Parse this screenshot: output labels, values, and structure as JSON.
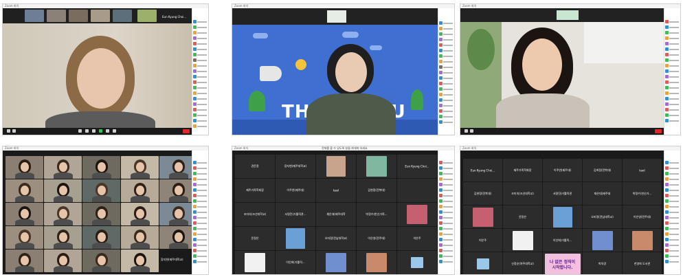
{
  "panels": {
    "p1": {
      "window_title": "Zoom 회의",
      "strip_name": "Eun Kyung Choi..."
    },
    "p2": {
      "window_title": "Zoom 회의",
      "slide_text": "THANK YOU"
    },
    "p3": {
      "window_title": "Zoom 회의"
    },
    "p4": {
      "window_title": "Zoom 회의",
      "tile_name": "장지현(제주대학교)"
    },
    "p5": {
      "window_title": "Zoom 회의",
      "top_banner": "전체를 볼 수 있도록 창을 최대화 하세요",
      "tiles": [
        [
          "권윤정",
          "장지현(제주대학교)",
          "",
          "",
          "Eun Kyung Choi..."
        ],
        [
          "제주가족학회장",
          "이주연(제주대)",
          "kaol",
          "김현정(전북대)",
          ""
        ],
        [
          "조미숙(조선대학교)",
          "서명진(가톨릭관...",
          "채은대(제주대학",
          "박정수(한신가족...",
          ""
        ],
        [
          "윤정은",
          "",
          "오미정(전남대학교)",
          "이은영(전주대)",
          "이은주"
        ],
        [
          "",
          "이인희(가톨릭...",
          "",
          "",
          ""
        ]
      ]
    },
    "p6": {
      "window_title": "Zoom 회의",
      "tiles": [
        [
          "Eun Kyung Choi...",
          "제주가족학회장",
          "이주연(제주대)",
          "김희정(전북대)",
          "kaol"
        ],
        [
          "김현정(전북대)",
          "조미숙(조선대학교)",
          "서명진(가톨릭관",
          "채은대(제주대",
          "박정수(한신가..."
        ],
        [
          "",
          "윤정은",
          "",
          "오미정(전남대학교)",
          "이은영(전주대)"
        ],
        [
          "이은주",
          "",
          "이인희(가톨릭...",
          "",
          ""
        ],
        [
          "",
          "신정순(여주대학교)",
          "",
          "박의경",
          "한영희 도서관"
        ]
      ],
      "poster_text": [
        "나 없은 정직이",
        "시작합니다."
      ]
    }
  },
  "colors": {
    "slide_blue": "#3f6fd0",
    "end_button": "#e02828",
    "zoom_dark": "#1a1a1a"
  }
}
